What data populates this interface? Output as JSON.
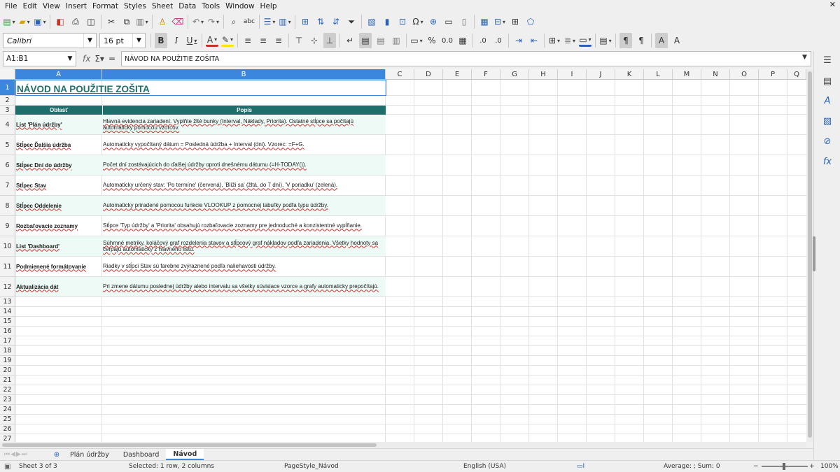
{
  "menu": [
    "File",
    "Edit",
    "View",
    "Insert",
    "Format",
    "Styles",
    "Sheet",
    "Data",
    "Tools",
    "Window",
    "Help"
  ],
  "toolbar": {
    "font_name": "Calibri",
    "font_size": "16 pt"
  },
  "formula_bar": {
    "name_box": "A1:B1",
    "content": "NÁVOD NA POUŽITIE ZOŠITA"
  },
  "columns": [
    "A",
    "B",
    "C",
    "D",
    "E",
    "F",
    "G",
    "H",
    "I",
    "J",
    "K",
    "L",
    "M",
    "N",
    "O",
    "P",
    "Q"
  ],
  "rows": [
    "1",
    "2",
    "3",
    "4",
    "5",
    "6",
    "7",
    "8",
    "9",
    "10",
    "11",
    "12",
    "13",
    "14",
    "15",
    "16",
    "17",
    "18",
    "19",
    "20",
    "21",
    "22",
    "23",
    "24",
    "25",
    "26",
    "27"
  ],
  "sheet": {
    "title": "NÁVOD NA POUŽITIE ZOŠITA",
    "headers": [
      "Oblasť",
      "Popis"
    ],
    "table": [
      {
        "area": "List 'Plán údržby'",
        "desc": "Hlavná evidencia zariadení. Vyplňte žlté bunky (Interval, Náklady, Priorita). Ostatné stĺpce sa počítajú automaticky pomocou vzorcov."
      },
      {
        "area": "Stĺpec Ďalšia údržba",
        "desc": "Automaticky vypočítaný dátum = Posledná údržba + Interval (dni). Vzorec: =F+G."
      },
      {
        "area": "Stĺpec Dní do údržby",
        "desc": "Počet dní zostávajúcich do ďalšej údržby oproti dnešnému dátumu (=H-TODAY())."
      },
      {
        "area": "Stĺpec Stav",
        "desc": "Automaticky určený stav: 'Po termíne' (červená), 'Blíži sa' (žltá, do 7 dní), 'V poriadku' (zelená)."
      },
      {
        "area": "Stĺpec Oddelenie",
        "desc": "Automaticky priradené pomocou funkcie VLOOKUP z pomocnej tabuľky podľa typu údržby."
      },
      {
        "area": "Rozbaľovacie zoznamy",
        "desc": "Stĺpce 'Typ údržby' a 'Priorita' obsahujú rozbaľovacie zoznamy pre jednoduché a konzistentné vypĺňanie."
      },
      {
        "area": "List 'Dashboard'",
        "desc": "Súhrnné metriky, koláčový graf rozdelenia stavov a stĺpcový graf nákladov podľa zariadenia. Všetky hodnoty sa čerpajú automaticky z hlavného listu."
      },
      {
        "area": "Podmienené formátovanie",
        "desc": "Riadky v stĺpci Stav sú farebne zvýraznené podľa naliehavosti údržby."
      },
      {
        "area": "Aktualizácia dát",
        "desc": "Pri zmene dátumu poslednej údržby alebo intervalu sa všetky súvisiace vzorce a grafy automaticky prepočítajú."
      }
    ]
  },
  "tabs": [
    "Plán údržby",
    "Dashboard",
    "Návod"
  ],
  "status": {
    "sheet": "Sheet 3 of 3",
    "selection": "Selected: 1 row, 2 columns",
    "page_style": "PageStyle_Návod",
    "language": "English (USA)",
    "sum": "Average: ; Sum: 0",
    "zoom": "100%"
  },
  "colors": {
    "accent": "#1e6e6b",
    "zebra": "#eefaf6",
    "selection": "#3b87dd"
  }
}
